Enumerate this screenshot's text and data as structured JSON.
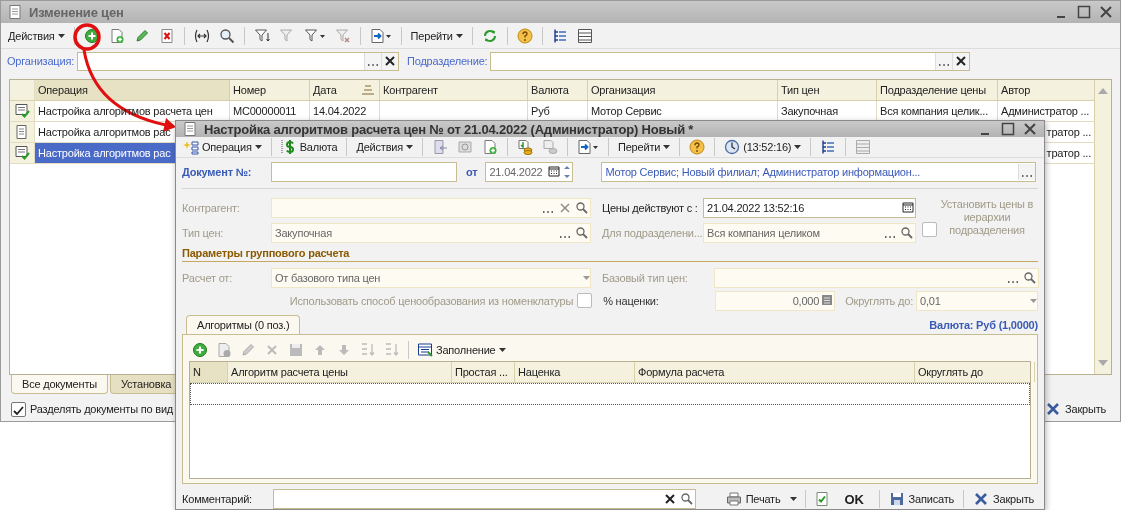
{
  "main_window": {
    "title": "Изменение цен",
    "toolbar": {
      "actions_menu": "Действия",
      "goto_menu": "Перейти"
    },
    "filters": [
      {
        "label": "Организация:"
      },
      {
        "label": "Подразделение:"
      }
    ],
    "table": {
      "columns": [
        "Операция",
        "Номер",
        "Дата",
        "Контрагент",
        "Валюта",
        "Организация",
        "Тип цен",
        "Подразделение цены",
        "Автор"
      ],
      "rows": [
        {
          "posted": true,
          "selected": false,
          "operation": "Настройка алгоритмов расчета цен",
          "number": "МС00000011",
          "date": "14.04.2022",
          "currency": "Руб",
          "organization": "Мотор Сервис",
          "price_type": "Закупочная",
          "division": "Вся компания целик...",
          "author": "Администратор ..."
        },
        {
          "posted": false,
          "selected": false,
          "operation": "Настройка алгоритмов рас",
          "author": "тратор ..."
        },
        {
          "posted": true,
          "selected": true,
          "operation": "Настройка алгоритмов рас",
          "author": "тратор ..."
        }
      ]
    },
    "tabs": [
      {
        "label": "Все документы",
        "selected": true
      },
      {
        "label": "Установка",
        "selected": false
      }
    ],
    "split_checkbox": {
      "label": "Разделять документы по вид",
      "checked": true
    },
    "close_button": "Закрыть"
  },
  "dialog": {
    "title": "Настройка алгоритмов расчета цен №  от 21.04.2022 (Администратор) Новый *",
    "toolbar": {
      "operation_menu": "Операция",
      "currency_button": "Валюта",
      "actions_menu": "Действия",
      "goto_menu": "Перейти",
      "time_menu": "(13:52:16)"
    },
    "document": {
      "label": "Документ №:",
      "date_label": "от",
      "date": "21.04.2022",
      "summary": "Мотор Сервис; Новый филиал; Администратор информацион..."
    },
    "counterparty": {
      "label": "Контрагент:"
    },
    "price_type": {
      "label": "Тип цен:",
      "value": "Закупочная"
    },
    "valid_from": {
      "label": "Цены действуют с :",
      "value": "21.04.2022 13:52:16"
    },
    "division": {
      "label": "Для подразделени...",
      "value": "Вся компания целиком"
    },
    "hierarchy": {
      "label": "Установить цены в иерархии подразделения",
      "checked": false
    },
    "group_params": {
      "title": "Параметры группового расчета",
      "calc_from": {
        "label": "Расчет от:",
        "value": "От базового типа цен"
      },
      "base_price_type": {
        "label": "Базовый тип цен:"
      },
      "use_method": {
        "label": "Использовать способ ценообразования из номенклатуры",
        "checked": false
      },
      "markup": {
        "label": "% наценки:",
        "value": "0,000"
      },
      "round": {
        "label": "Округлять до:",
        "value": "0,01"
      }
    },
    "tabs": [
      {
        "label": "Алгоритмы (0 поз.)",
        "selected": true
      }
    ],
    "currency_info": "Валюта: Руб (1,0000)",
    "algorithms": {
      "fill_menu": "Заполнение",
      "columns": [
        "N",
        "Алгоритм расчета цены",
        "Простая ...",
        "Наценка",
        "Формула расчета",
        "Округлять до"
      ]
    },
    "comment": {
      "label": "Комментарий:"
    },
    "buttons": {
      "print": "Печать",
      "ok": "OK",
      "save": "Записать",
      "close": "Закрыть"
    }
  }
}
